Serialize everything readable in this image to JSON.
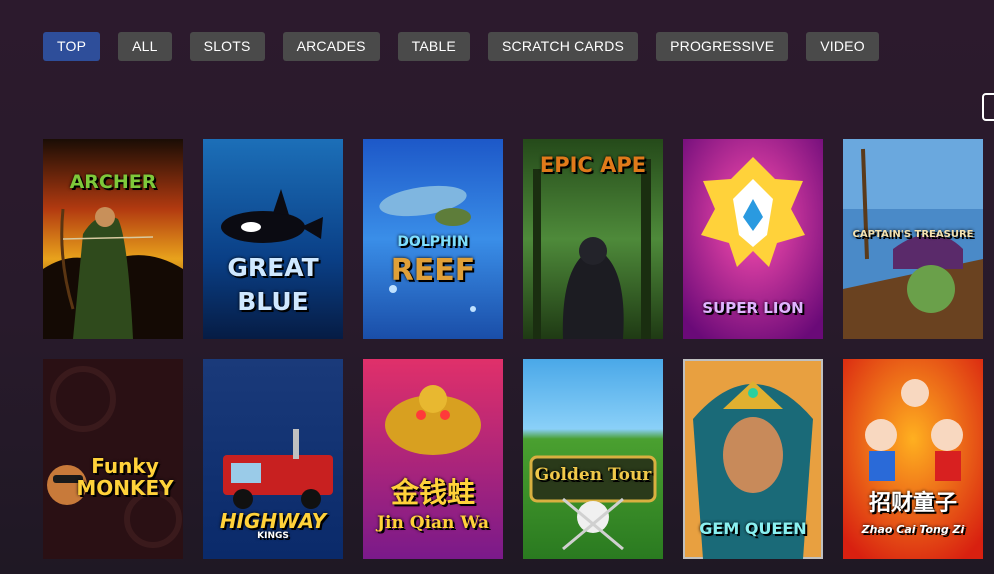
{
  "tabs": [
    {
      "label": "TOP"
    },
    {
      "label": "ALL"
    },
    {
      "label": "SLOTS"
    },
    {
      "label": "ARCADES"
    },
    {
      "label": "TABLE"
    },
    {
      "label": "SCRATCH CARDS"
    },
    {
      "label": "PROGRESSIVE"
    },
    {
      "label": "VIDEO"
    }
  ],
  "active_tab": "TOP",
  "games": [
    {
      "title": "ARCHER"
    },
    {
      "title_line1": "GREAT",
      "title_line2": "BLUE"
    },
    {
      "title_line1": "DOLPHIN",
      "title_line2": "REEF"
    },
    {
      "title": "EPIC APE"
    },
    {
      "title": "SUPER LION"
    },
    {
      "title": "CAPTAIN'S TREASURE"
    },
    {
      "title_line1": "Funky",
      "title_line2": "MONKEY"
    },
    {
      "title": "HIGHWAY",
      "subtitle": "KINGS"
    },
    {
      "title_cn": "金钱蛙",
      "title": "Jin Qian Wa"
    },
    {
      "title": "Golden Tour"
    },
    {
      "title": "GEM QUEEN"
    },
    {
      "title_cn": "招财童子",
      "title": "Zhao Cai Tong Zi"
    }
  ],
  "colors": {
    "background": "#2a1a2c",
    "tab_bg": "#4a4a4a",
    "tab_active_bg": "#2e4e9a",
    "tab_text": "#ffffff"
  }
}
